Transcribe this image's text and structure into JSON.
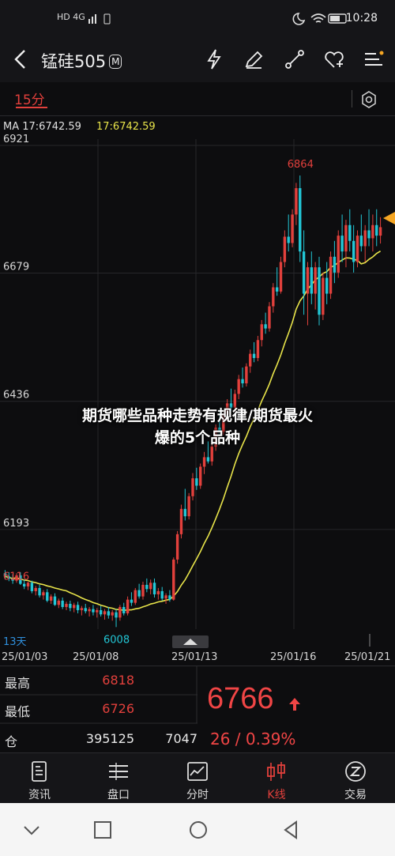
{
  "status_bar": {
    "left": "HD 4G",
    "time": "10:28"
  },
  "header": {
    "title": "锰硅505",
    "badge": "M"
  },
  "toolbar": {
    "period": "15分"
  },
  "ma_legend": {
    "left": "MA 17:6742.59",
    "right": "17:6742.59"
  },
  "colors": {
    "up": "#e2403c",
    "down": "#22c7d6",
    "ma": "#e8e44a",
    "accent": "#f5a623"
  },
  "chart_data": {
    "type": "candlestick",
    "y_ticks": [
      "6921",
      "6679",
      "6436",
      "6193"
    ],
    "ylim": [
      6010,
      6921
    ],
    "x_labels": [
      "25/01/03",
      "25/01/08",
      "25/01/13",
      "25/01/16",
      "25/01/21"
    ],
    "annotations": {
      "high": "6864",
      "low": "6008",
      "left": "6116"
    },
    "days_label": "13天",
    "ma_period": 17,
    "ma_last": 6742.59,
    "candles": [
      [
        6110,
        6116,
        6098,
        6104
      ],
      [
        6104,
        6112,
        6095,
        6100
      ],
      [
        6100,
        6108,
        6090,
        6096
      ],
      [
        6096,
        6110,
        6092,
        6106
      ],
      [
        6106,
        6112,
        6088,
        6090
      ],
      [
        6090,
        6098,
        6080,
        6085
      ],
      [
        6085,
        6094,
        6078,
        6092
      ],
      [
        6092,
        6096,
        6072,
        6076
      ],
      [
        6076,
        6086,
        6068,
        6082
      ],
      [
        6082,
        6088,
        6064,
        6068
      ],
      [
        6068,
        6078,
        6060,
        6074
      ],
      [
        6074,
        6080,
        6055,
        6058
      ],
      [
        6058,
        6070,
        6052,
        6066
      ],
      [
        6066,
        6072,
        6048,
        6050
      ],
      [
        6050,
        6062,
        6044,
        6058
      ],
      [
        6058,
        6064,
        6042,
        6046
      ],
      [
        6046,
        6056,
        6040,
        6052
      ],
      [
        6052,
        6058,
        6038,
        6044
      ],
      [
        6044,
        6054,
        6036,
        6050
      ],
      [
        6050,
        6056,
        6034,
        6040
      ],
      [
        6040,
        6048,
        6030,
        6044
      ],
      [
        6044,
        6052,
        6034,
        6038
      ],
      [
        6038,
        6046,
        6028,
        6042
      ],
      [
        6042,
        6050,
        6030,
        6036
      ],
      [
        6036,
        6044,
        6026,
        6040
      ],
      [
        6040,
        6048,
        6028,
        6032
      ],
      [
        6032,
        6042,
        6022,
        6038
      ],
      [
        6038,
        6046,
        6024,
        6030
      ],
      [
        6030,
        6040,
        6020,
        6036
      ],
      [
        6036,
        6042,
        6008,
        6026
      ],
      [
        6026,
        6050,
        6020,
        6046
      ],
      [
        6046,
        6054,
        6030,
        6034
      ],
      [
        6034,
        6066,
        6030,
        6060
      ],
      [
        6060,
        6074,
        6048,
        6054
      ],
      [
        6054,
        6082,
        6050,
        6078
      ],
      [
        6078,
        6090,
        6062,
        6066
      ],
      [
        6066,
        6094,
        6060,
        6088
      ],
      [
        6088,
        6100,
        6074,
        6080
      ],
      [
        6080,
        6098,
        6070,
        6092
      ],
      [
        6092,
        6100,
        6064,
        6070
      ],
      [
        6070,
        6082,
        6060,
        6076
      ],
      [
        6076,
        6084,
        6058,
        6062
      ],
      [
        6062,
        6072,
        6052,
        6068
      ],
      [
        6068,
        6078,
        6056,
        6060
      ],
      [
        6060,
        6140,
        6058,
        6136
      ],
      [
        6136,
        6190,
        6128,
        6184
      ],
      [
        6184,
        6240,
        6176,
        6232
      ],
      [
        6232,
        6270,
        6210,
        6218
      ],
      [
        6218,
        6262,
        6212,
        6256
      ],
      [
        6256,
        6300,
        6248,
        6290
      ],
      [
        6290,
        6310,
        6268,
        6276
      ],
      [
        6276,
        6318,
        6270,
        6312
      ],
      [
        6312,
        6340,
        6298,
        6330
      ],
      [
        6330,
        6360,
        6318,
        6322
      ],
      [
        6322,
        6356,
        6314,
        6350
      ],
      [
        6350,
        6392,
        6342,
        6386
      ],
      [
        6386,
        6420,
        6370,
        6378
      ],
      [
        6378,
        6418,
        6372,
        6410
      ],
      [
        6410,
        6440,
        6398,
        6432
      ],
      [
        6432,
        6460,
        6418,
        6424
      ],
      [
        6424,
        6458,
        6416,
        6450
      ],
      [
        6450,
        6486,
        6440,
        6478
      ],
      [
        6478,
        6500,
        6462,
        6470
      ],
      [
        6470,
        6508,
        6464,
        6502
      ],
      [
        6502,
        6534,
        6490,
        6526
      ],
      [
        6526,
        6548,
        6510,
        6518
      ],
      [
        6518,
        6560,
        6512,
        6552
      ],
      [
        6552,
        6590,
        6540,
        6582
      ],
      [
        6582,
        6604,
        6564,
        6574
      ],
      [
        6574,
        6624,
        6568,
        6616
      ],
      [
        6616,
        6660,
        6604,
        6652
      ],
      [
        6652,
        6690,
        6636,
        6644
      ],
      [
        6644,
        6710,
        6640,
        6700
      ],
      [
        6700,
        6760,
        6690,
        6748
      ],
      [
        6748,
        6790,
        6720,
        6736
      ],
      [
        6736,
        6800,
        6728,
        6790
      ],
      [
        6790,
        6850,
        6770,
        6840
      ],
      [
        6840,
        6864,
        6700,
        6720
      ],
      [
        6720,
        6760,
        6600,
        6640
      ],
      [
        6640,
        6700,
        6580,
        6690
      ],
      [
        6690,
        6720,
        6620,
        6640
      ],
      [
        6640,
        6700,
        6610,
        6690
      ],
      [
        6690,
        6710,
        6580,
        6600
      ],
      [
        6600,
        6680,
        6590,
        6670
      ],
      [
        6670,
        6700,
        6620,
        6640
      ],
      [
        6640,
        6720,
        6630,
        6710
      ],
      [
        6710,
        6740,
        6660,
        6680
      ],
      [
        6680,
        6760,
        6670,
        6750
      ],
      [
        6750,
        6790,
        6700,
        6720
      ],
      [
        6720,
        6780,
        6690,
        6770
      ],
      [
        6770,
        6800,
        6720,
        6740
      ],
      [
        6740,
        6770,
        6680,
        6700
      ],
      [
        6700,
        6760,
        6690,
        6750
      ],
      [
        6750,
        6790,
        6720,
        6730
      ],
      [
        6730,
        6770,
        6700,
        6760
      ],
      [
        6760,
        6800,
        6730,
        6745
      ],
      [
        6745,
        6790,
        6720,
        6770
      ],
      [
        6770,
        6800,
        6730,
        6750
      ],
      [
        6750,
        6785,
        6735,
        6766
      ]
    ]
  },
  "stats": {
    "rows": [
      {
        "label": "最高",
        "value": "6818"
      },
      {
        "label": "最低",
        "value": "6726"
      },
      {
        "label": "仓",
        "value": "395125",
        "extra": "7047"
      }
    ],
    "price": "6766",
    "change": "26 / 0.39%"
  },
  "nav": [
    {
      "label": "资讯",
      "icon": "news-icon"
    },
    {
      "label": "盘口",
      "icon": "orderbook-icon"
    },
    {
      "label": "分时",
      "icon": "timeshare-icon"
    },
    {
      "label": "K线",
      "icon": "candlestick-icon",
      "active": true
    },
    {
      "label": "交易",
      "icon": "trade-icon"
    }
  ],
  "overlay": {
    "line1": "期货哪些品种走势有规律/期货最火",
    "line2": "爆的5个品种"
  }
}
